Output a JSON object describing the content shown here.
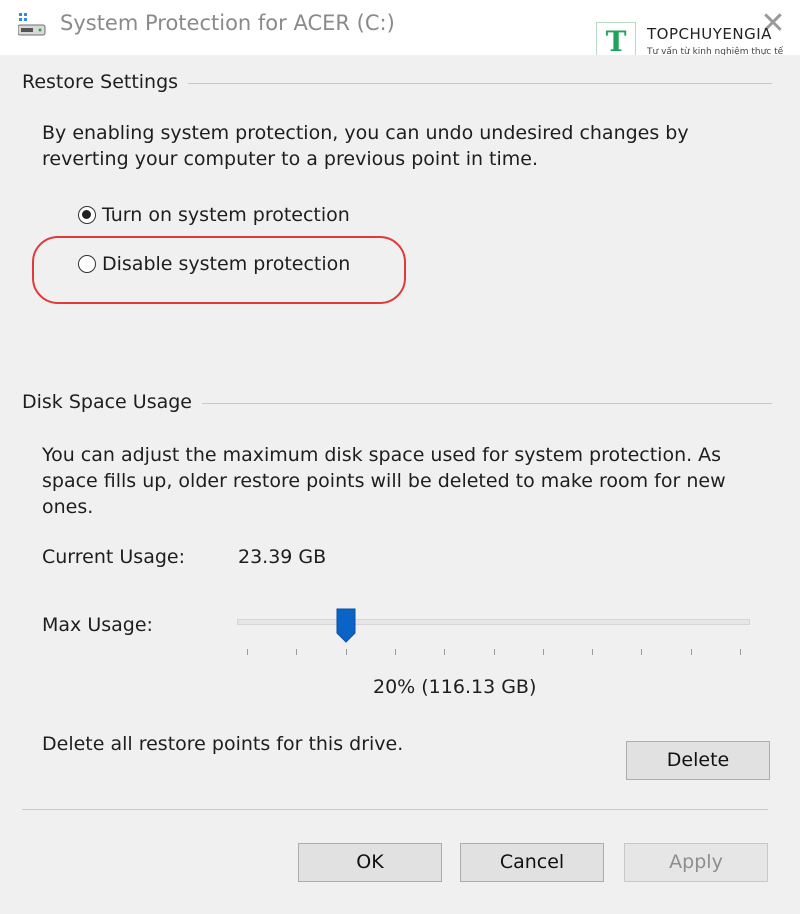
{
  "window": {
    "title": "System Protection for ACER (C:)",
    "close_glyph": "✕"
  },
  "watermark": {
    "letter": "T",
    "name": "TOPCHUYENGIA",
    "tagline": "Tư vấn từ kinh nghiệm thực tế"
  },
  "restore": {
    "group_title": "Restore Settings",
    "description_line1": "By enabling system protection, you can undo undesired changes by",
    "description_line2": "reverting your computer to a previous point in time.",
    "options": [
      {
        "label": "Turn on system protection",
        "checked": true
      },
      {
        "label": "Disable system protection",
        "checked": false
      }
    ]
  },
  "disk": {
    "group_title": "Disk Space Usage",
    "description_line1": "You can adjust the maximum disk space used for system protection. As",
    "description_line2": "space fills up, older restore points will be deleted to make room for new",
    "description_line3": "ones.",
    "current_usage_label": "Current Usage:",
    "current_usage_value": "23.39 GB",
    "max_usage_label": "Max Usage:",
    "max_usage_percent": 20,
    "max_usage_text": "20% (116.13 GB)",
    "delete_text": "Delete all restore points for this drive.",
    "delete_button": "Delete"
  },
  "buttons": {
    "ok": "OK",
    "cancel": "Cancel",
    "apply": "Apply"
  },
  "colors": {
    "highlight": "#e03a3a",
    "slider_thumb": "#0a64c8",
    "brand_green": "#1ea35a"
  }
}
